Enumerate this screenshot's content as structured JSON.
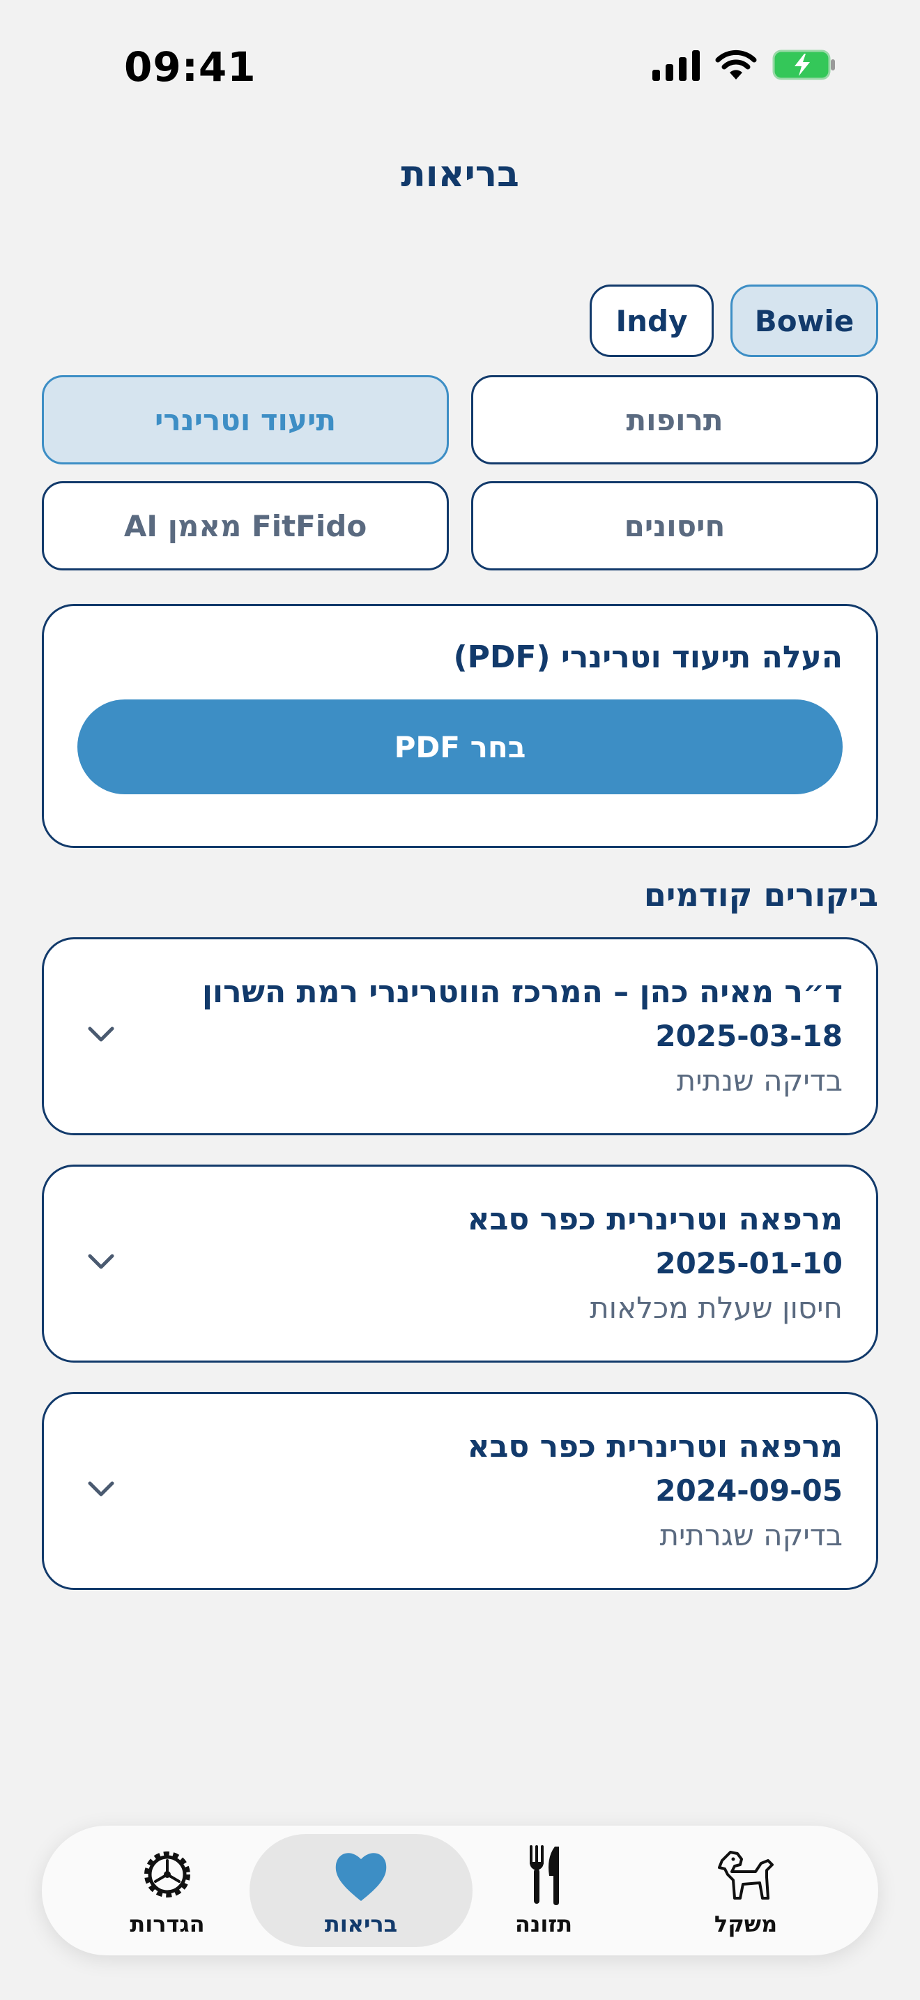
{
  "status_bar": {
    "time": "09:41"
  },
  "header": {
    "title": "בריאות"
  },
  "pets": [
    {
      "name": "Bowie",
      "selected": true
    },
    {
      "name": "Indy",
      "selected": false
    }
  ],
  "segments": [
    {
      "label": "תרופות",
      "selected": false
    },
    {
      "label": "תיעוד וטרינרי",
      "selected": true
    },
    {
      "label": "חיסונים",
      "selected": false
    },
    {
      "label": "FitFido מאמן AI",
      "selected": false
    }
  ],
  "upload": {
    "title": "העלה תיעוד וטרינרי (PDF)",
    "button_label": "בחר PDF"
  },
  "previous_visits": {
    "heading": "ביקורים קודמים",
    "items": [
      {
        "title": "ד״ר מאיה כהן – המרכז הווטרינרי רמת השרון",
        "date": "2025-03-18",
        "type": "בדיקה שנתית"
      },
      {
        "title": "מרפאה וטרינרית כפר סבא",
        "date": "2025-01-10",
        "type": "חיסון שעלת מכלאות"
      },
      {
        "title": "מרפאה וטרינרית כפר סבא",
        "date": "2024-09-05",
        "type": "בדיקה שגרתית"
      }
    ]
  },
  "tab_bar": {
    "items": [
      {
        "label": "משקל",
        "icon": "dog-icon",
        "active": false
      },
      {
        "label": "תזונה",
        "icon": "fork-knife-icon",
        "active": false
      },
      {
        "label": "בריאות",
        "icon": "heart-icon",
        "active": true
      },
      {
        "label": "הגדרות",
        "icon": "gear-icon",
        "active": false
      }
    ]
  },
  "colors": {
    "navy": "#123a6b",
    "accent_blue": "#3d8ec5",
    "selected_fill": "#d6e4ef",
    "background": "#f2f2f2",
    "battery_green": "#34c759"
  }
}
